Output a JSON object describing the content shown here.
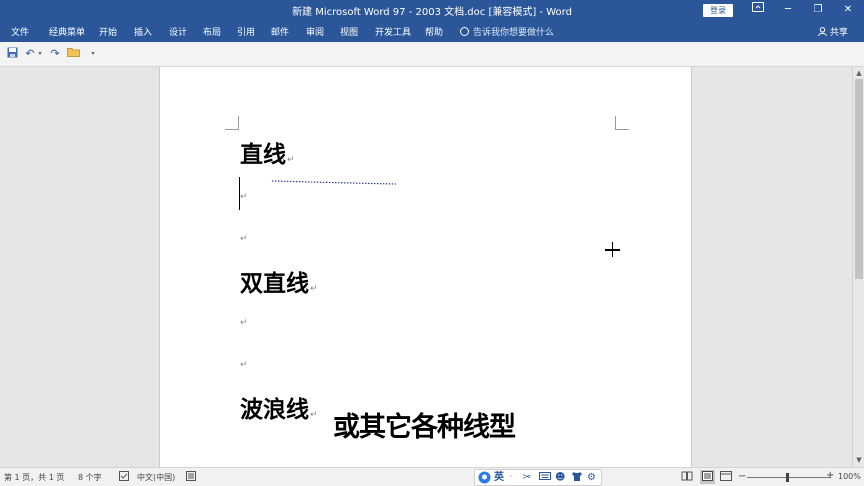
{
  "window": {
    "title": "新建 Microsoft Word 97 - 2003 文档.doc [兼容模式]  -  Word",
    "login_label": "登录",
    "minimize": "─",
    "restore": "❐",
    "close": "✕"
  },
  "menu": {
    "items": [
      "文件",
      "经典菜单",
      "开始",
      "插入",
      "设计",
      "布局",
      "引用",
      "邮件",
      "审阅",
      "视图",
      "开发工具",
      "帮助"
    ],
    "tellme_placeholder": "告诉我你想要做什么",
    "share_label": "共享"
  },
  "qat": {
    "save": "save-icon",
    "undo": "undo-icon",
    "redo": "redo-icon",
    "open": "folder-icon",
    "customize": "customize-icon"
  },
  "document": {
    "heading1": "直线",
    "heading2": "双直线",
    "heading3": "波浪线",
    "paragraph_mark": "↵"
  },
  "overlay": {
    "subtitle": "或其它各种线型"
  },
  "status": {
    "page": "第 1 页，共 1 页",
    "words": "8 个字",
    "language": "中文(中国)",
    "ime_lang": "英",
    "zoom": "100%"
  },
  "colors": {
    "accent": "#2b579a",
    "dotted_line": "#2b3e8c"
  }
}
